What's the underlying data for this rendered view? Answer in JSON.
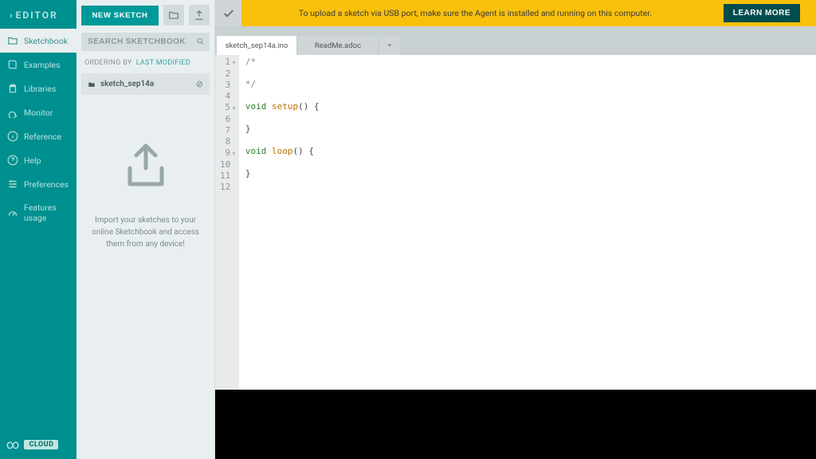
{
  "rail": {
    "logo": "EDITOR",
    "items": [
      {
        "icon": "folder",
        "label": "Sketchbook",
        "active": true
      },
      {
        "icon": "book",
        "label": "Examples"
      },
      {
        "icon": "clipboard",
        "label": "Libraries"
      },
      {
        "icon": "monitor",
        "label": "Monitor"
      },
      {
        "icon": "info",
        "label": "Reference"
      },
      {
        "icon": "help",
        "label": "Help"
      },
      {
        "icon": "sliders",
        "label": "Preferences"
      },
      {
        "icon": "gauge",
        "label": "Features usage"
      }
    ],
    "cloud_label": "CLOUD"
  },
  "sketchbook": {
    "new_button": "NEW SKETCH",
    "search_placeholder": "SEARCH SKETCHBOOK",
    "ordering_prefix": "ORDERING BY",
    "ordering_link": "LAST MODIFIED",
    "entries": [
      {
        "name": "sketch_sep14a"
      }
    ],
    "import_message": "Import your sketches to your online Sketchbook and access them from any device!"
  },
  "banner": {
    "text": "To upload a sketch via USB port, make sure the Agent is installed and running on this computer.",
    "button": "LEARN MORE"
  },
  "tabs": [
    {
      "label": "sketch_sep14a.ino",
      "active": true
    },
    {
      "label": "ReadMe.adoc",
      "active": false
    }
  ],
  "code": {
    "lines": [
      {
        "n": 1,
        "fold": true,
        "html": "<span class='cm'>/*</span>"
      },
      {
        "n": 2,
        "fold": false,
        "html": ""
      },
      {
        "n": 3,
        "fold": false,
        "html": "<span class='cm'>*/</span>"
      },
      {
        "n": 4,
        "fold": false,
        "html": ""
      },
      {
        "n": 5,
        "fold": true,
        "html": "<span class='kw'>void</span> <span class='fn'>setup</span>() {"
      },
      {
        "n": 6,
        "fold": false,
        "html": ""
      },
      {
        "n": 7,
        "fold": false,
        "html": "}"
      },
      {
        "n": 8,
        "fold": false,
        "html": ""
      },
      {
        "n": 9,
        "fold": true,
        "html": "<span class='kw'>void</span> <span class='fn'>loop</span>() {"
      },
      {
        "n": 10,
        "fold": false,
        "html": ""
      },
      {
        "n": 11,
        "fold": false,
        "html": "}"
      },
      {
        "n": 12,
        "fold": false,
        "html": ""
      }
    ]
  }
}
